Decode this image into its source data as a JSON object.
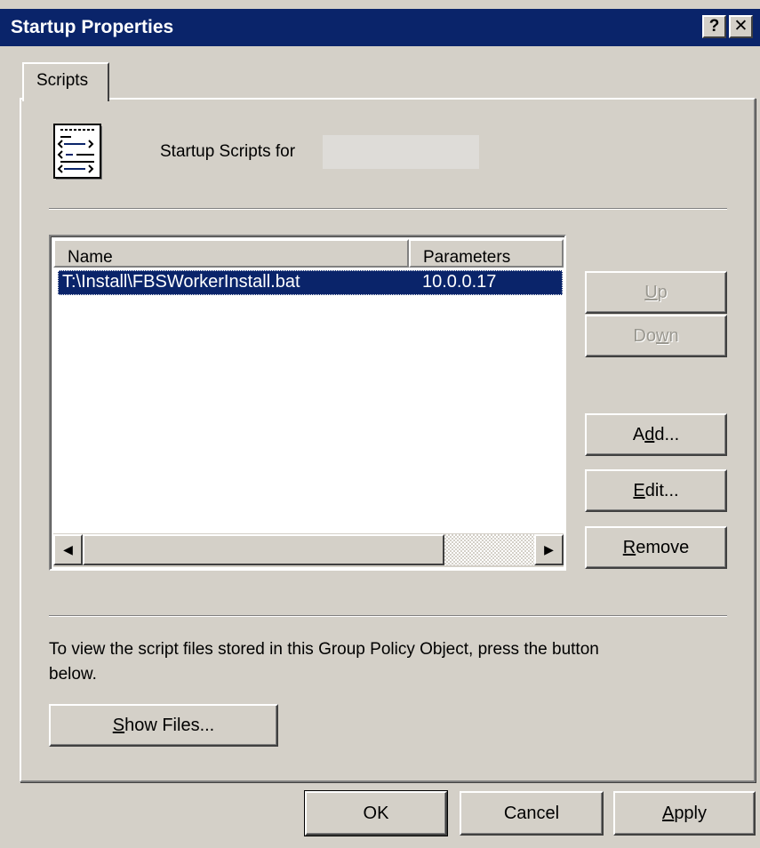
{
  "window": {
    "title": "Startup Properties",
    "help_glyph": "?",
    "close_glyph": "✕"
  },
  "tabs": [
    {
      "label": "Scripts",
      "selected": true
    }
  ],
  "header": {
    "icon": "script-file-icon",
    "text": "Startup Scripts for"
  },
  "scripts_list": {
    "columns": [
      "Name",
      "Parameters"
    ],
    "rows": [
      {
        "name": "T:\\Install\\FBSWorkerInstall.bat",
        "parameters": "10.0.0.17",
        "selected": true
      }
    ],
    "scroll_left_glyph": "◀",
    "scroll_right_glyph": "▶"
  },
  "side_buttons": {
    "up": {
      "pre": "",
      "key": "U",
      "post": "p",
      "enabled": false
    },
    "down": {
      "pre": "Do",
      "key": "w",
      "post": "n",
      "enabled": false
    },
    "add": {
      "pre": "A",
      "key": "d",
      "post": "d...",
      "enabled": true
    },
    "edit": {
      "pre": "",
      "key": "E",
      "post": "dit...",
      "enabled": true
    },
    "remove": {
      "pre": "",
      "key": "R",
      "post": "emove",
      "enabled": true
    }
  },
  "info_text": "To view the script files stored in this Group Policy Object, press the button below.",
  "show_files": {
    "pre": "",
    "key": "S",
    "post": "how Files..."
  },
  "footer": {
    "ok": "OK",
    "cancel": "Cancel",
    "apply": {
      "pre": "",
      "key": "A",
      "post": "pply"
    }
  },
  "colors": {
    "titlebar": "#0a246a",
    "face": "#d4d0c8",
    "selection": "#0a246a"
  }
}
